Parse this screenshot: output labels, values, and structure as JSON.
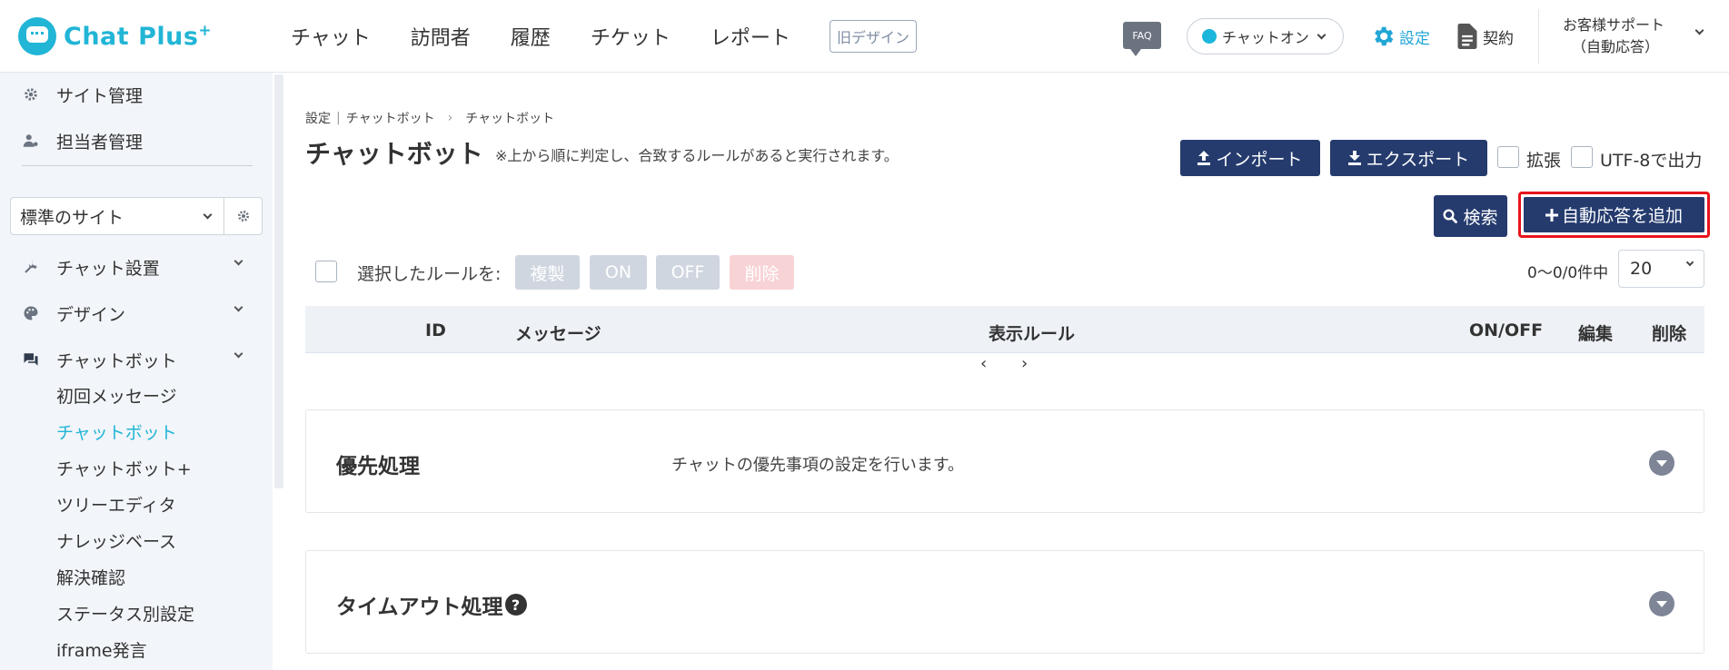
{
  "header": {
    "logo_text": "Chat Plus",
    "logo_plus": "+",
    "nav": [
      "チャット",
      "訪問者",
      "履歴",
      "チケット",
      "レポート"
    ],
    "old_design": "旧デザイン",
    "faq": "FAQ",
    "status": "チャットオン",
    "settings": "設定",
    "contract": "契約",
    "user_line1": "お客様サポート",
    "user_line2": "（自動応答）",
    "accent_color": "#21b5d6"
  },
  "sidebar": {
    "top_items": [
      "サイト管理",
      "担当者管理"
    ],
    "site_select": "標準のサイト",
    "sections": [
      "チャット設置",
      "デザイン",
      "チャットボット"
    ],
    "chatbot_subitems": [
      "初回メッセージ",
      "チャットボット",
      "チャットボット+",
      "ツリーエディタ",
      "ナレッジベース",
      "解決確認",
      "ステータス別設定",
      "iframe発言"
    ],
    "active_subitem": "チャットボット"
  },
  "main": {
    "breadcrumb": [
      "設定",
      "チャットボット",
      "チャットボット"
    ],
    "breadcrumb_sep1": "|",
    "breadcrumb_sep2": "›",
    "title": "チャットボット",
    "note": "※上から順に判定し、合致するルールがあると実行されます。",
    "import_label": "インポート",
    "export_label": "エクスポート",
    "extend_label": "拡張",
    "utf8_label": "UTF-8で出力",
    "search_label": "検索",
    "add_label": "自動応答を追加",
    "bulk_label": "選択したルールを:",
    "bulk_buttons": [
      "複製",
      "ON",
      "OFF",
      "削除"
    ],
    "count": "0〜0/0件中",
    "per_page": "20",
    "columns": [
      "ID",
      "メッセージ",
      "表示ルール",
      "ON/OFF",
      "編集",
      "削除"
    ],
    "pager_prev": "‹",
    "pager_next": "›",
    "panels": [
      {
        "title": "優先処理",
        "desc": "チャットの優先事項の設定を行います。"
      },
      {
        "title": "タイムアウト処理",
        "desc": ""
      }
    ],
    "help_mark": "?",
    "navy_color": "#253b6e",
    "highlight_color": "#e8141b"
  }
}
